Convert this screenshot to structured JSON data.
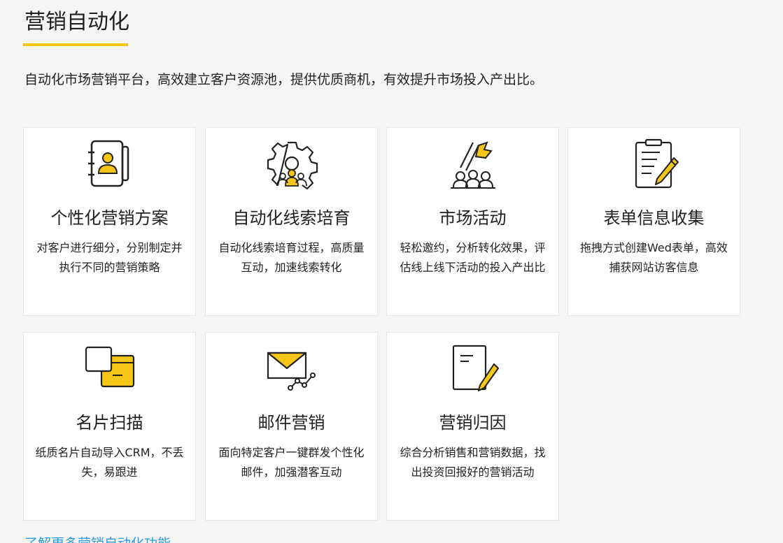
{
  "section": {
    "title": "营销自动化",
    "subtitle": "自动化市场营销平台，高效建立客户资源池，提供优质商机，有效提升市场投入产出比。",
    "accent_color": "#f5c518",
    "link_color": "#2a9be0",
    "more_link": "了解更多营销自动化功能"
  },
  "cards": [
    {
      "icon": "contact-book-icon",
      "title": "个性化营销方案",
      "desc": "对客户进行细分，分别制定并执行不同的营销策略"
    },
    {
      "icon": "gear-people-icon",
      "title": "自动化线索培育",
      "desc": "自动化线索培育过程，高质量互动，加速线索转化"
    },
    {
      "icon": "flag-crowd-icon",
      "title": "市场活动",
      "desc": "轻松邀约，分析转化效果，评估线上线下活动的投入产出比"
    },
    {
      "icon": "clipboard-pencil-icon",
      "title": "表单信息收集",
      "desc": "拖拽方式创建Wed表单，高效捕获网站访客信息"
    },
    {
      "icon": "card-scan-icon",
      "title": "名片扫描",
      "desc": "纸质名片自动导入CRM，不丢失，易跟进"
    },
    {
      "icon": "envelope-chart-icon",
      "title": "邮件营销",
      "desc": "面向特定客户一键群发个性化邮件，加强潜客互动"
    },
    {
      "icon": "document-pencil-icon",
      "title": "营销归因",
      "desc": "综合分析销售和营销数据，找出投资回报好的营销活动"
    }
  ]
}
